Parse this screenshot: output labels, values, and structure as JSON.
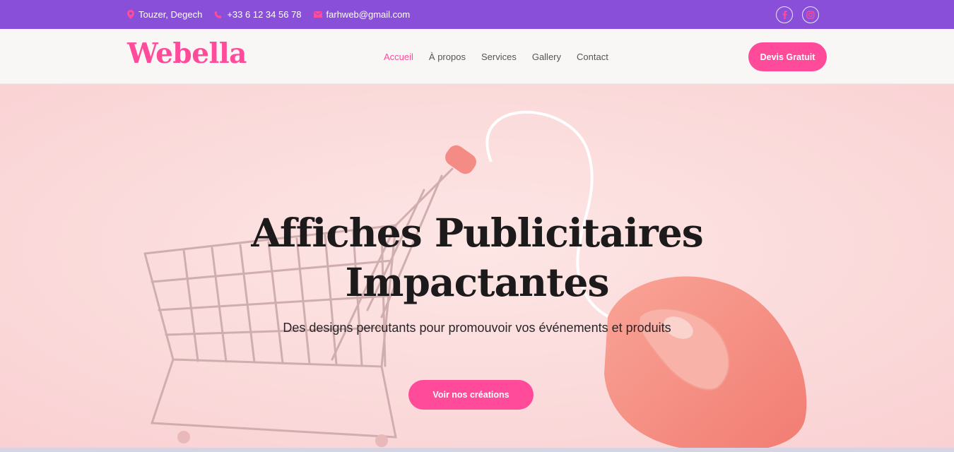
{
  "topbar": {
    "location": "Touzer, Degech",
    "phone": "+33 6 12 34 56 78",
    "email": "farhweb@gmail.com",
    "icons": {
      "location": "map-pin-icon",
      "phone": "phone-icon",
      "email": "envelope-icon",
      "social_1": "facebook-icon",
      "social_2": "instagram-icon"
    },
    "icon_color": "#ff4b9a",
    "background": "#8a4fd8"
  },
  "navbar": {
    "logo": "Webella",
    "links": [
      "Accueil",
      "À propos",
      "Services",
      "Gallery",
      "Contact"
    ],
    "active_link": "Accueil",
    "cta_label": "Devis Gratuit"
  },
  "hero": {
    "title_line_1": "Affiches Publicitaires",
    "title_line_2": "Impactantes",
    "subtitle": "Des designs percutants pour promouvoir vos événements et produits",
    "button_label": "Voir nos créations",
    "background_color": "#fde0e0"
  },
  "colors": {
    "accent": "#ff4b9a",
    "purple": "#8a4fd8"
  }
}
